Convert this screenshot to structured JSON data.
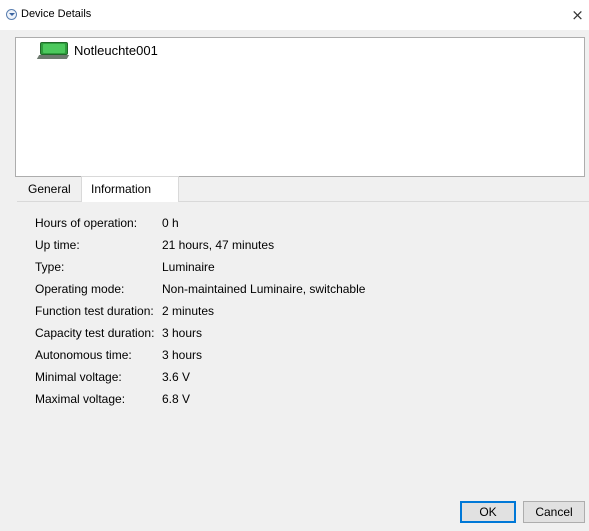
{
  "window": {
    "title": "Device Details",
    "close_glyph": "×"
  },
  "device": {
    "name": "Notleuchte001",
    "icon": "emergency-luminaire-icon"
  },
  "tabs": [
    {
      "label": "General",
      "selected": false
    },
    {
      "label": "Information",
      "selected": true
    }
  ],
  "information": [
    {
      "label": "Hours of operation:",
      "value": "0 h"
    },
    {
      "label": "Up time:",
      "value": "21 hours, 47 minutes"
    },
    {
      "label": "Type:",
      "value": "Luminaire"
    },
    {
      "label": "Operating mode:",
      "value": "Non-maintained Luminaire, switchable"
    },
    {
      "label": "Function test duration:",
      "value": "2 minutes"
    },
    {
      "label": "Capacity test duration:",
      "value": "3 hours"
    },
    {
      "label": "Autonomous time:",
      "value": "3 hours"
    },
    {
      "label": "Minimal voltage:",
      "value": "3.6 V"
    },
    {
      "label": "Maximal voltage:",
      "value": "6.8 V"
    }
  ],
  "buttons": {
    "ok": "OK",
    "cancel": "Cancel"
  },
  "colors": {
    "dialog_background": "#f0f0f0",
    "default_button_border": "#0078d7",
    "device_icon_green": "#2f9e3e"
  }
}
